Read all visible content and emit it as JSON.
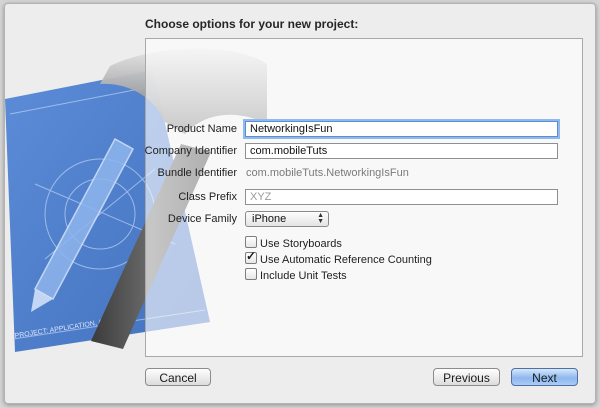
{
  "dialog": {
    "title": "Choose options for your new project:"
  },
  "form": {
    "product_name": {
      "label": "Product Name",
      "value": "NetworkingIsFun"
    },
    "company_identifier": {
      "label": "Company Identifier",
      "value": "com.mobileTuts"
    },
    "bundle_identifier": {
      "label": "Bundle Identifier",
      "value": "com.mobileTuts.NetworkingIsFun"
    },
    "class_prefix": {
      "label": "Class Prefix",
      "placeholder": "XYZ"
    },
    "device_family": {
      "label": "Device Family",
      "selected": "iPhone"
    },
    "options": [
      {
        "label": "Use Storyboards",
        "checked": false
      },
      {
        "label": "Use Automatic Reference Counting",
        "checked": true
      },
      {
        "label": "Include Unit Tests",
        "checked": false
      }
    ]
  },
  "buttons": {
    "cancel": "Cancel",
    "previous": "Previous",
    "next": "Next"
  },
  "art": {
    "blueprint_text": "PROJECT: APPLICATION, APP"
  }
}
